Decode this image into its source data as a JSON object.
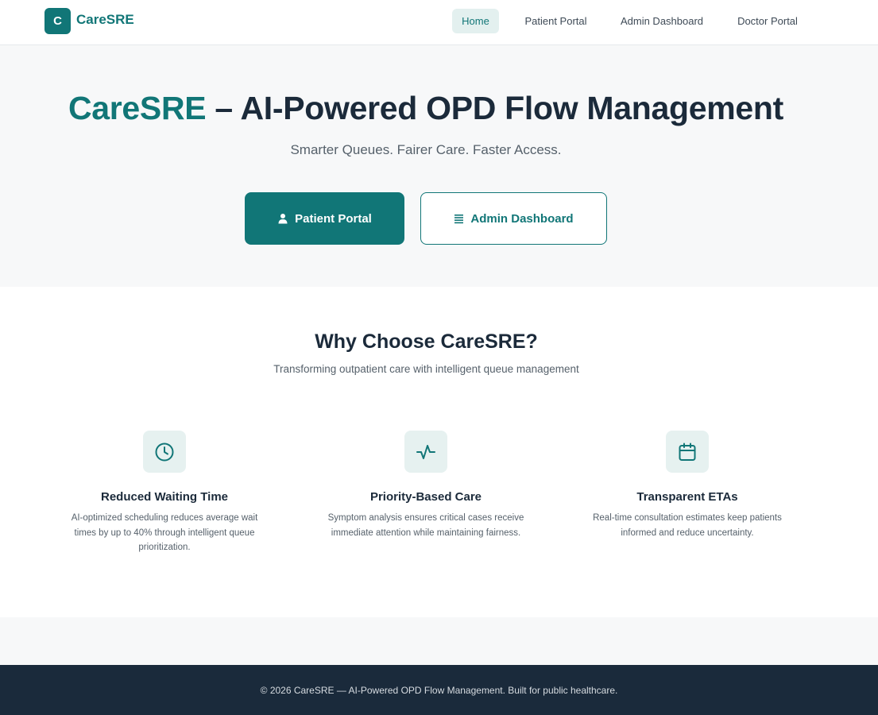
{
  "header": {
    "logo_letter": "C",
    "brand": "CareSRE",
    "nav": [
      {
        "label": "Home",
        "active": true
      },
      {
        "label": "Patient Portal",
        "active": false
      },
      {
        "label": "Admin Dashboard",
        "active": false
      },
      {
        "label": "Doctor Portal",
        "active": false
      }
    ]
  },
  "hero": {
    "title_accent": "CareSRE",
    "title_rest": " – AI-Powered OPD Flow Management",
    "subtitle": "Smarter Queues. Fairer Care. Faster Access.",
    "primary_button": {
      "label": "Patient Portal",
      "icon": "user-icon"
    },
    "secondary_button": {
      "label": "Admin Dashboard",
      "icon": "list-icon"
    }
  },
  "features": {
    "title": "Why Choose CareSRE?",
    "subtitle": "Transforming outpatient care with intelligent queue management",
    "items": [
      {
        "icon": "clock-icon",
        "title": "Reduced Waiting Time",
        "description": "AI-optimized scheduling reduces average wait times by up to 40% through intelligent queue prioritization."
      },
      {
        "icon": "activity-icon",
        "title": "Priority-Based Care",
        "description": "Symptom analysis ensures critical cases receive immediate attention while maintaining fairness."
      },
      {
        "icon": "calendar-icon",
        "title": "Transparent ETAs",
        "description": "Real-time consultation estimates keep patients informed and reduce uncertainty."
      }
    ]
  },
  "footer": {
    "text": "© 2026 CareSRE — AI-Powered OPD Flow Management. Built for public healthcare."
  },
  "colors": {
    "accent": "#117677",
    "dark": "#1b2a3a",
    "footer_bg": "#1a2a3b",
    "hero_bg": "#f7f8f9",
    "icon_bg": "#e6f1f0"
  }
}
